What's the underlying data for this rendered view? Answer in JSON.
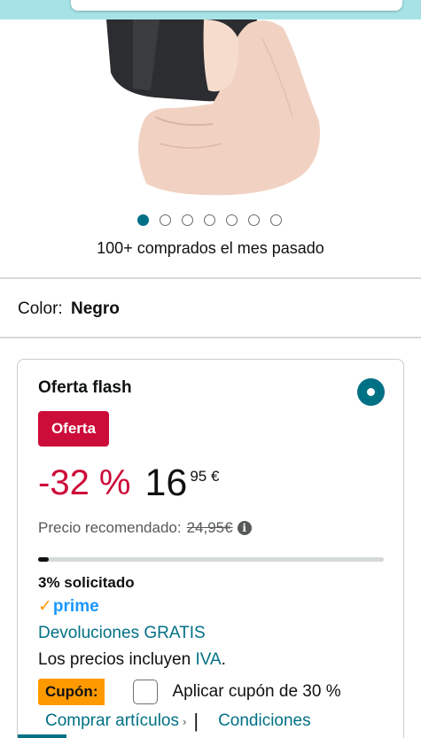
{
  "gallery": {
    "image_alt": "power bank held in hand",
    "dots": [
      true,
      false,
      false,
      false,
      false,
      false,
      false
    ]
  },
  "social_proof": "100+ comprados el mes pasado",
  "color": {
    "label": "Color:",
    "value": "Negro"
  },
  "offer": {
    "title": "Oferta flash",
    "badge": "Oferta",
    "discount": "-32 %",
    "price_whole": "16",
    "price_fraction": "95 €",
    "recommended_label": "Precio recomendado:",
    "recommended_price": "24,95€",
    "info_icon": "i",
    "claimed_fraction": 0.03,
    "claimed_text": "3% solicitado",
    "prime_check": "✓",
    "prime_text": "prime",
    "returns": "Devoluciones GRATIS",
    "vat_prefix": "Los precios incluyen ",
    "vat_link": "IVA",
    "vat_suffix": ".",
    "coupon_tag": "Cupón:",
    "coupon_text": "Aplicar cupón de 30 %",
    "shop_link": "Comprar artículos",
    "shop_chevron": "›",
    "separator": "|",
    "conditions_link": "Condiciones"
  },
  "colors": {
    "accent": "#007185",
    "deal_red": "#cc0c39",
    "prime_blue": "#1a98ff",
    "coupon_orange": "#ff9900"
  }
}
